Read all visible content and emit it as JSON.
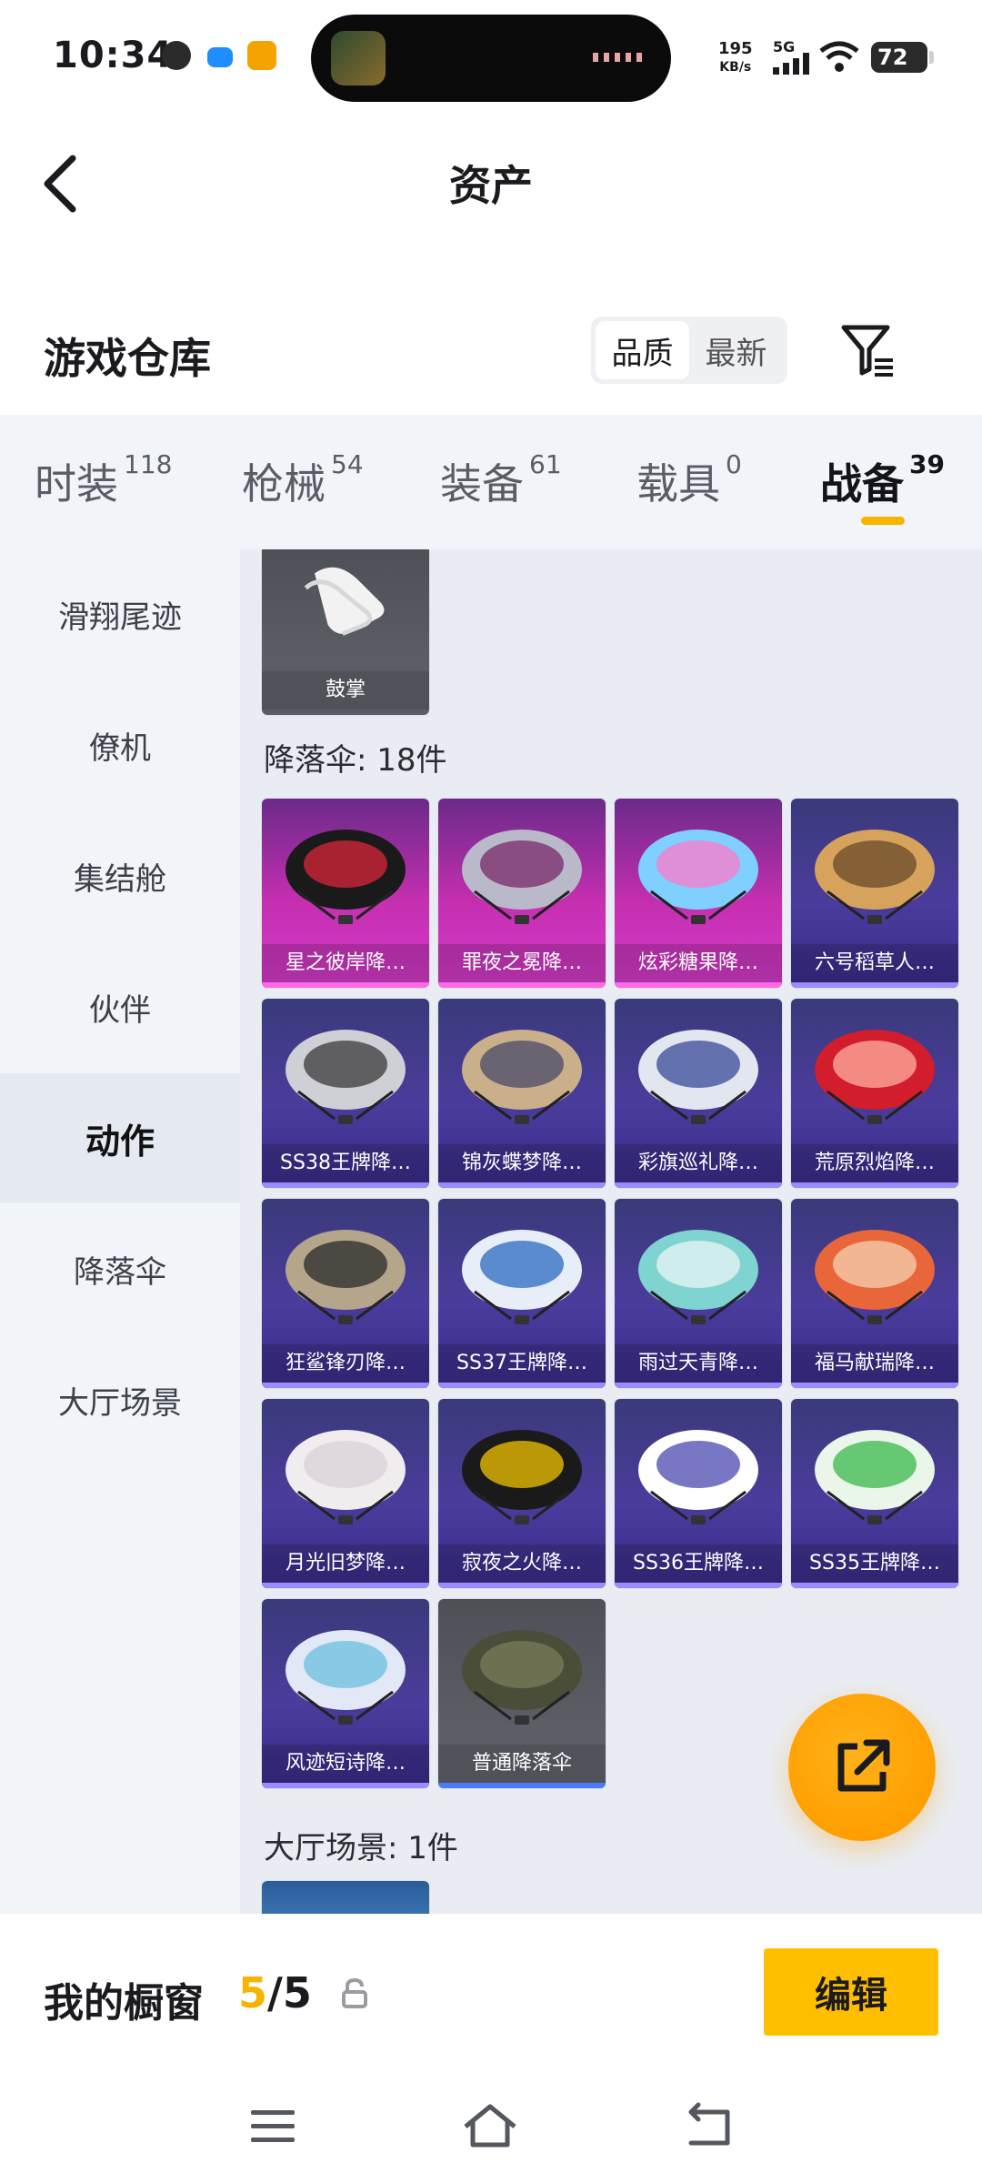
{
  "status_bar": {
    "time": "10:34",
    "net_speed_value": "195",
    "net_speed_unit": "KB/s",
    "signal_label": "5G",
    "battery": "72"
  },
  "nav": {
    "title": "资产"
  },
  "warehouse": {
    "title": "游戏仓库",
    "sort_options": [
      "品质",
      "最新"
    ],
    "active_sort": "品质"
  },
  "tabs": [
    {
      "label": "时装",
      "count": "118"
    },
    {
      "label": "枪械",
      "count": "54"
    },
    {
      "label": "装备",
      "count": "61"
    },
    {
      "label": "载具",
      "count": "0"
    },
    {
      "label": "战备",
      "count": "39",
      "active": true
    }
  ],
  "sidebar": {
    "items": [
      "滑翔尾迹",
      "僚机",
      "集结舱",
      "伙伴",
      "动作",
      "降落伞",
      "大厅场景"
    ],
    "active": "动作"
  },
  "content": {
    "top_card": {
      "label": "鼓掌"
    },
    "parachute_section": "降落伞: 18件",
    "parachutes": [
      {
        "label": "星之彼岸降…",
        "tier": "pink"
      },
      {
        "label": "罪夜之冕降…",
        "tier": "pink"
      },
      {
        "label": "炫彩糖果降…",
        "tier": "pink"
      },
      {
        "label": "六号稻草人…",
        "tier": "purple"
      },
      {
        "label": "SS38王牌降…",
        "tier": "purple"
      },
      {
        "label": "锦灰蝶梦降…",
        "tier": "purple"
      },
      {
        "label": "彩旗巡礼降…",
        "tier": "purple"
      },
      {
        "label": "荒原烈焰降…",
        "tier": "purple"
      },
      {
        "label": "狂鲨锋刃降…",
        "tier": "purple"
      },
      {
        "label": "SS37王牌降…",
        "tier": "purple"
      },
      {
        "label": "雨过天青降…",
        "tier": "purple"
      },
      {
        "label": "福马献瑞降…",
        "tier": "purple"
      },
      {
        "label": "月光旧梦降…",
        "tier": "purple"
      },
      {
        "label": "寂夜之火降…",
        "tier": "purple"
      },
      {
        "label": "SS36王牌降…",
        "tier": "purple"
      },
      {
        "label": "SS35王牌降…",
        "tier": "purple"
      },
      {
        "label": "风迹短诗降…",
        "tier": "purple"
      },
      {
        "label": "普通降落伞",
        "tier": "gray"
      }
    ],
    "lobby_section": "大厅场景: 1件"
  },
  "showcase": {
    "label": "我的橱窗",
    "current": "5",
    "separator": "/",
    "total": "5",
    "edit_label": "编辑"
  },
  "colors": {
    "accent": "#f6b300",
    "fab": "#ff9f00",
    "edit_button": "#ffbf00",
    "rare_pink": "#d63ccc",
    "epic_purple": "#4a3c9c"
  }
}
